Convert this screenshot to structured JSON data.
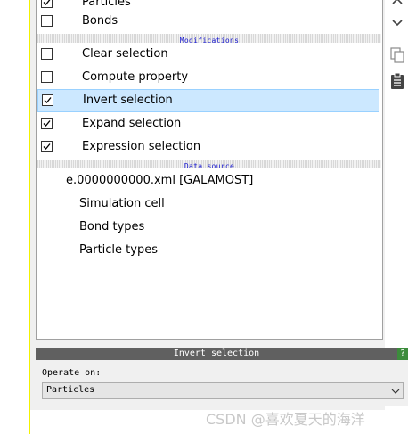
{
  "pipeline": {
    "partial_top": {
      "label": "Particles",
      "checked": true
    },
    "top_items": [
      {
        "label": "Bonds",
        "checked": false
      }
    ],
    "modifications_header": "Modifications",
    "modifications": [
      {
        "label": "Clear selection",
        "checked": false,
        "selected": false
      },
      {
        "label": "Compute property",
        "checked": false,
        "selected": false
      },
      {
        "label": "Invert selection",
        "checked": true,
        "selected": true
      },
      {
        "label": "Expand selection",
        "checked": true,
        "selected": false
      },
      {
        "label": "Expression selection",
        "checked": true,
        "selected": false
      }
    ],
    "data_source_header": "Data source",
    "data_source": {
      "file": "e.0000000000.xml [GALAMOST]",
      "children": [
        "Simulation cell",
        "Bond types",
        "Particle types"
      ]
    }
  },
  "side_tools": [
    "chevron-up-icon",
    "chevron-down-icon",
    "copy-icon",
    "clipboard-icon"
  ],
  "properties": {
    "title": "Invert selection",
    "help_label": "?",
    "operate_on_label": "Operate on:",
    "operate_on_value": "Particles"
  },
  "watermark": "CSDN @喜欢夏天的海洋",
  "colors": {
    "selection_bg": "#cce8ff",
    "section_header_text": "#1a1ad0",
    "properties_header_bg": "#606060",
    "help_button_bg": "#3c8c3c",
    "yellow_edge": "#f2f200"
  }
}
